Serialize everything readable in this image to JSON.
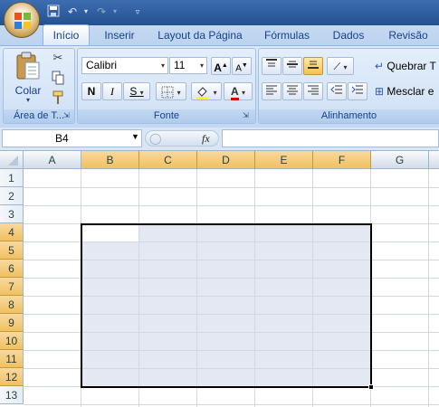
{
  "quick_access": {
    "save_icon": "save-icon",
    "undo_icon": "undo-icon",
    "redo_icon": "redo-icon",
    "customize_icon": "customize-arrow-icon"
  },
  "tabs": [
    {
      "label": "Início",
      "active": true
    },
    {
      "label": "Inserir"
    },
    {
      "label": "Layout da Página"
    },
    {
      "label": "Fórmulas"
    },
    {
      "label": "Dados"
    },
    {
      "label": "Revisão"
    }
  ],
  "clipboard": {
    "paste_label": "Colar",
    "group_label": "Área de T..."
  },
  "font": {
    "name": "Calibri",
    "size": "11",
    "bold": "N",
    "italic": "I",
    "underline": "S",
    "grow": "A",
    "shrink": "A",
    "color_label": "A",
    "group_label": "Fonte"
  },
  "alignment": {
    "wrap_label": "Quebrar T",
    "merge_label": "Mesclar e",
    "group_label": "Alinhamento"
  },
  "formula_bar": {
    "name_box": "B4",
    "fx": "fx",
    "formula": ""
  },
  "columns": [
    "A",
    "B",
    "C",
    "D",
    "E",
    "F",
    "G"
  ],
  "rows": [
    "1",
    "2",
    "3",
    "4",
    "5",
    "6",
    "7",
    "8",
    "9",
    "10",
    "11",
    "12",
    "13"
  ],
  "selection": {
    "active_cell": "B4",
    "range": "B4:F12"
  },
  "colors": {
    "ribbon": "#cadcf3",
    "selected_header": "#f1c15f",
    "selection_fill": "#e4e8f3",
    "title_bar": "#24508f"
  }
}
